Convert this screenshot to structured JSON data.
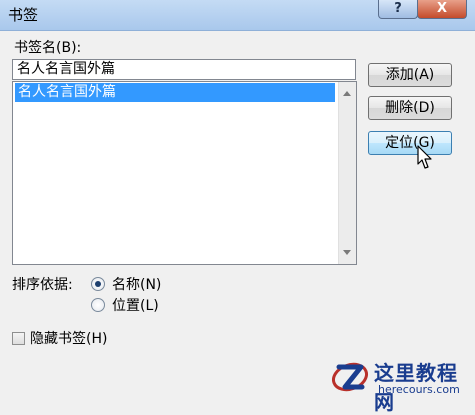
{
  "window": {
    "title": "书签",
    "help_label": "?",
    "close_label": "X"
  },
  "bookmark": {
    "name_label": "书签名(B):",
    "name_value": "名人名言国外篇",
    "list_items": [
      "名人名言国外篇"
    ]
  },
  "buttons": {
    "add": "添加(A)",
    "delete": "删除(D)",
    "goto": "定位(G)"
  },
  "sort": {
    "label": "排序依据:",
    "options": [
      {
        "label": "名称(N)",
        "selected": true
      },
      {
        "label": "位置(L)",
        "selected": false
      }
    ]
  },
  "hidden": {
    "label": "隐藏书签(H)",
    "checked": false
  },
  "watermark": {
    "name": "这里教程网",
    "domain": "herecours.com"
  },
  "colors": {
    "selection": "#3399ff",
    "watermark": "#1a3d8f",
    "close_button": "#c44b2b"
  }
}
